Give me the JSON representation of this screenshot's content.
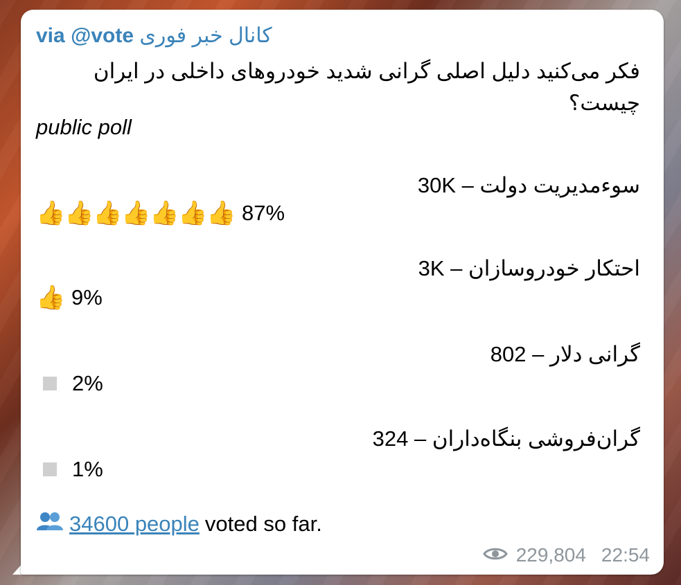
{
  "message": {
    "via_prefix": "via",
    "via_handle": "@vote",
    "channel_name": "کانال خبر فوری",
    "question": "فکر می‌کنید دلیل اصلی گرانی شدید خودروهای داخلی در ایران چیست؟",
    "poll_type": "public poll",
    "options": [
      {
        "label": "سوءمدیریت دولت – 30K",
        "percent": "87%",
        "thumb_count": 7
      },
      {
        "label": "احتکار خودروسازان – 3K",
        "percent": "9%",
        "thumb_count": 1
      },
      {
        "label": "گرانی دلار – 802",
        "percent": "2%",
        "thumb_count": 0
      },
      {
        "label": "گران‌فروشی بنگاه‌داران – 324",
        "percent": "1%",
        "thumb_count": 0
      }
    ],
    "voters_link": "34600 people",
    "voters_suffix": "voted so far.",
    "views": "229,804",
    "time": "22:54"
  },
  "icons": {
    "thumb": "thumbs-up-icon",
    "empty": "empty-box-icon",
    "people": "people-icon",
    "views": "eye-icon"
  },
  "colors": {
    "link": "#3a83b9",
    "meta": "#8e969c",
    "thumb": "#f2b61f"
  }
}
